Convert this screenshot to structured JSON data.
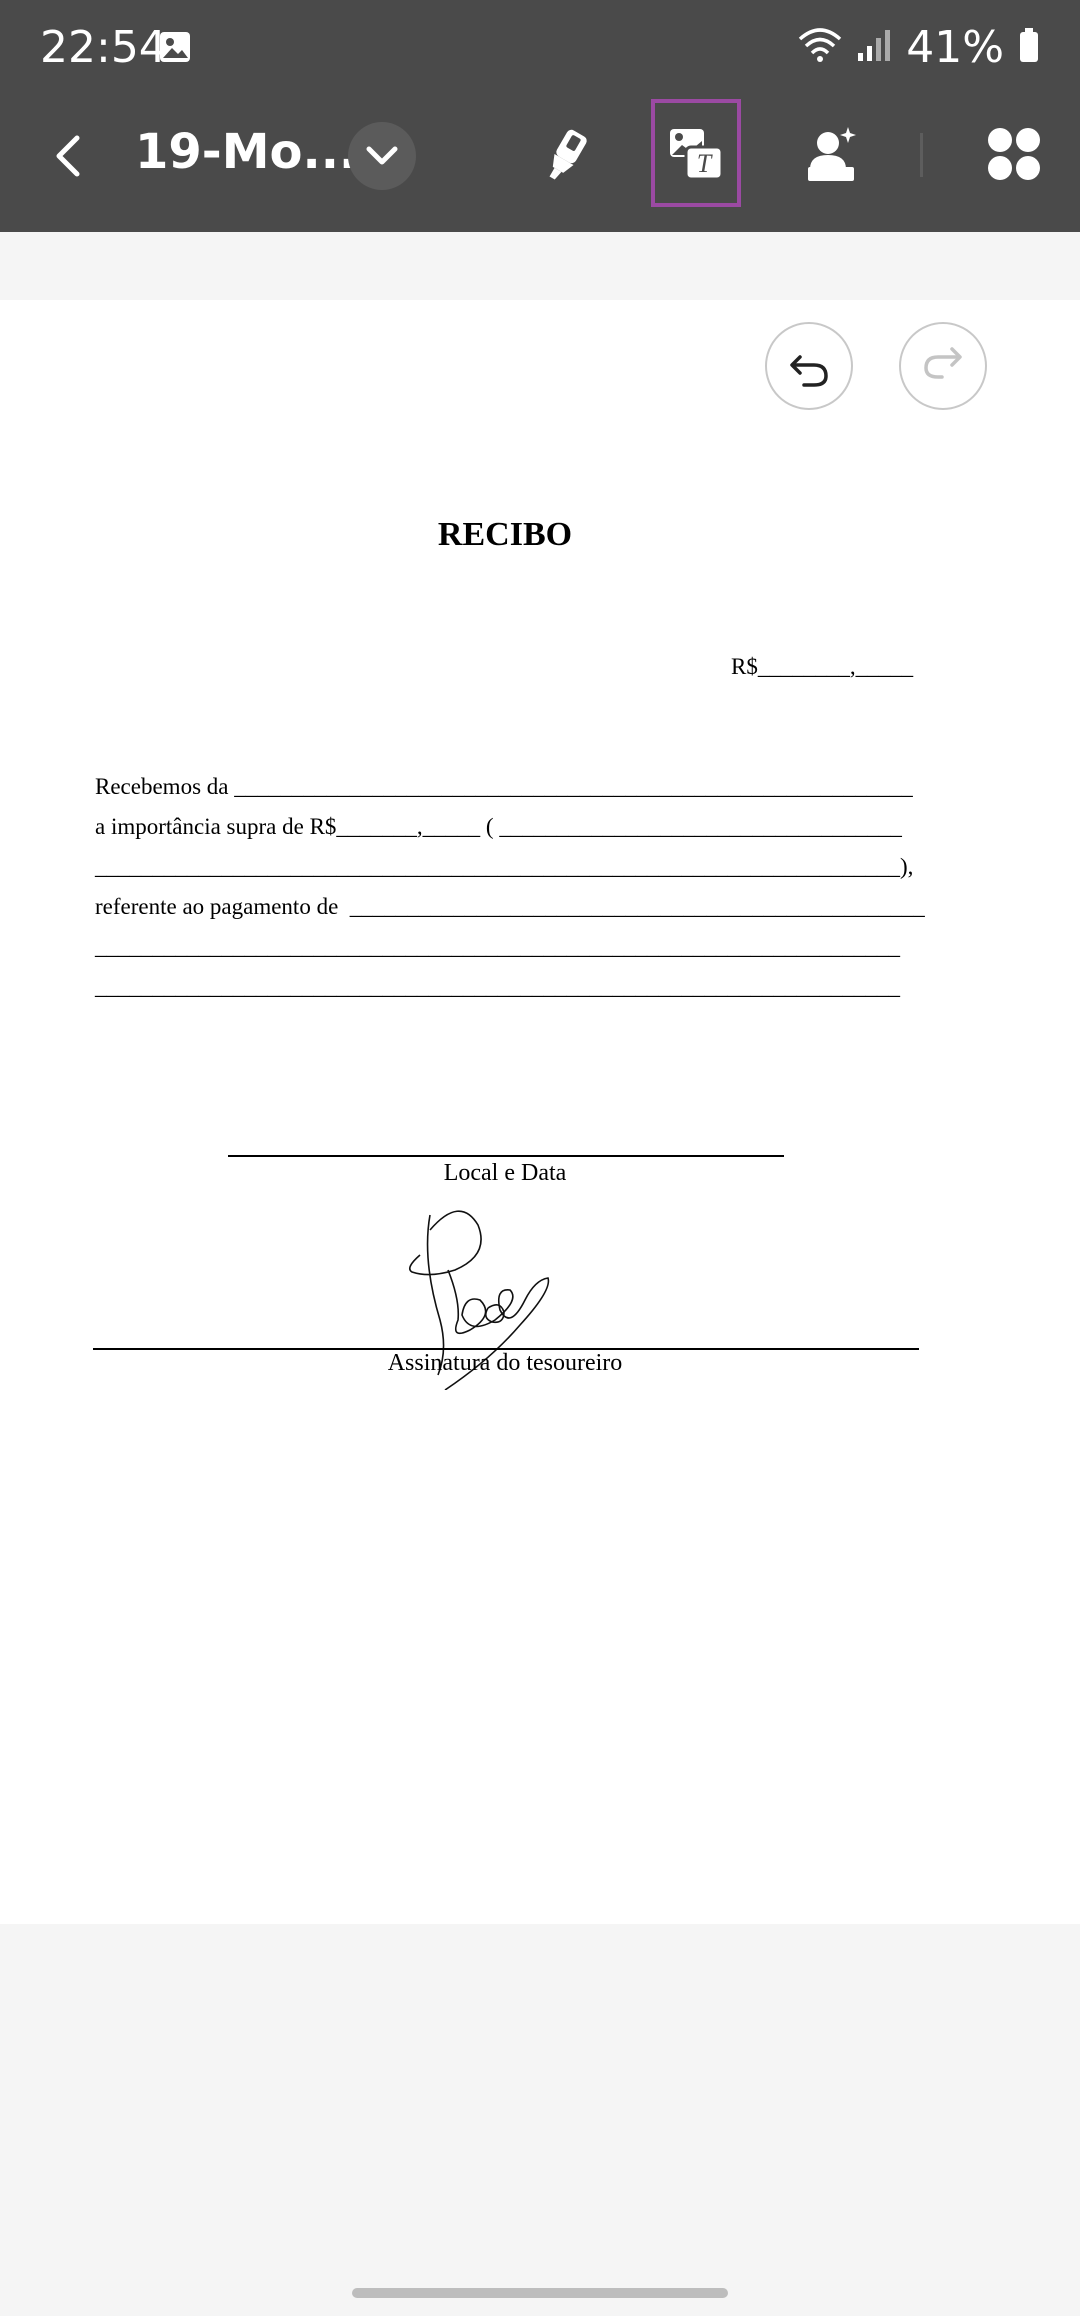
{
  "status_bar": {
    "time": "22:54",
    "battery": "41%"
  },
  "toolbar": {
    "title": "19-Mo...",
    "icons": [
      "back-arrow-icon",
      "chevron-down-icon",
      "highlighter-icon",
      "image-text-icon",
      "sign-stamp-icon",
      "apps-grid-icon"
    ]
  },
  "doc": {
    "title": "RECIBO",
    "amount_line": "R$________,_____",
    "lines": [
      "Recebemos da ___________________________________________________________",
      "a importância supra de R$_______,_____ ( ___________________________________",
      "______________________________________________________________________),",
      "referente ao pagamento de  __________________________________________________",
      "______________________________________________________________________",
      "______________________________________________________________________"
    ],
    "local_data_label": "Local e Data",
    "signature_label": "Assinatura do tesoureiro"
  },
  "colors": {
    "toolbar_bg": "#4a4a4a",
    "accent": "#9b4aa3",
    "page_bg": "#ffffff",
    "canvas_bg": "#f5f5f5"
  }
}
